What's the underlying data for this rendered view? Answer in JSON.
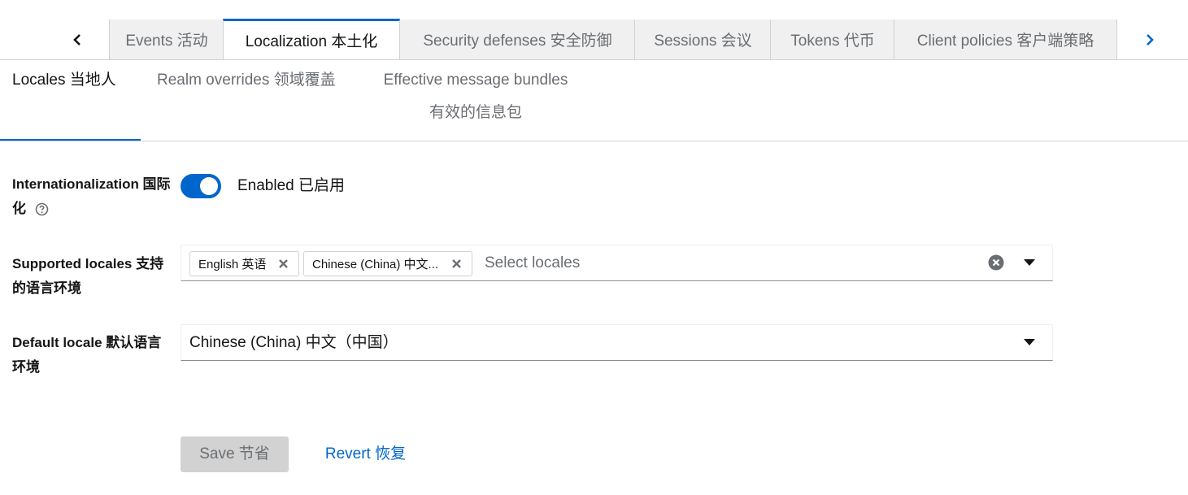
{
  "top_tabs": {
    "items": [
      {
        "label": "Events  活动"
      },
      {
        "label": "Localization  本土化"
      },
      {
        "label": "Security defenses  安全防御"
      },
      {
        "label": "Sessions  会议"
      },
      {
        "label": "Tokens  代币"
      },
      {
        "label": "Client policies  客户端策略"
      }
    ],
    "active_index": 1,
    "left_icon": "chevron-left-icon",
    "right_icon": "chevron-right-icon"
  },
  "sub_tabs": {
    "items": [
      {
        "label": "Locales  当地人"
      },
      {
        "label": "Realm overrides  领域覆盖"
      },
      {
        "label_line1": "Effective message bundles",
        "label_line2": "有效的信息包"
      }
    ],
    "active_index": 0
  },
  "form": {
    "internationalization": {
      "label": "Internationalization  国际化",
      "help_icon": "help-circle-icon",
      "toggle_on": true,
      "toggle_label": "Enabled  已启用"
    },
    "supported_locales": {
      "label": "Supported locales  支持的语言环境",
      "chips": [
        {
          "label": "English  英语"
        },
        {
          "label": "Chinese (China)  中文..."
        }
      ],
      "placeholder": "Select locales"
    },
    "default_locale": {
      "label": "Default locale  默认语言环境",
      "value": "Chinese (China)  中文（中国）"
    }
  },
  "actions": {
    "save_label": "Save  节省",
    "revert_label": "Revert  恢复"
  },
  "colors": {
    "accent": "#0066cc",
    "disabled_bg": "#d2d2d2",
    "muted_text": "#6a6e73",
    "tab_bg": "#f0f0f0"
  }
}
